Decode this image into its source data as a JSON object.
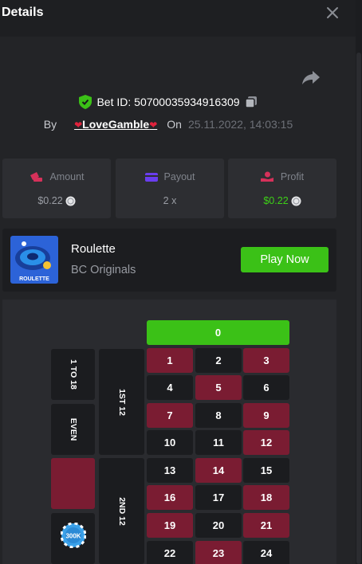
{
  "header": {
    "title": "Details"
  },
  "bet": {
    "id_label": "Bet ID: 50700035934916309",
    "by_label": "By",
    "user": "LoveGamble",
    "on_label": "On",
    "date": "25.11.2022, 14:03:15"
  },
  "stats": {
    "amount": {
      "label": "Amount",
      "value": "$0.22"
    },
    "payout": {
      "label": "Payout",
      "value": "2 x"
    },
    "profit": {
      "label": "Profit",
      "value": "$0.22"
    }
  },
  "game": {
    "thumb_label": "ROULETTE",
    "name": "Roulette",
    "provider": "BC Originals",
    "play_label": "Play Now"
  },
  "board": {
    "zero": "0",
    "side_bets": {
      "low": "1 TO 18",
      "even": "EVEN",
      "dozen1": "1ST 12",
      "dozen2": "2ND 12"
    },
    "chip_label": "300K",
    "numbers": [
      [
        "1",
        "red"
      ],
      [
        "2",
        "black"
      ],
      [
        "3",
        "red"
      ],
      [
        "4",
        "black"
      ],
      [
        "5",
        "red"
      ],
      [
        "6",
        "black"
      ],
      [
        "7",
        "red"
      ],
      [
        "8",
        "black"
      ],
      [
        "9",
        "red"
      ],
      [
        "10",
        "black"
      ],
      [
        "11",
        "black"
      ],
      [
        "12",
        "red"
      ],
      [
        "13",
        "black"
      ],
      [
        "14",
        "red"
      ],
      [
        "15",
        "black"
      ],
      [
        "16",
        "red"
      ],
      [
        "17",
        "black"
      ],
      [
        "18",
        "red"
      ],
      [
        "19",
        "red"
      ],
      [
        "20",
        "black"
      ],
      [
        "21",
        "red"
      ],
      [
        "22",
        "black"
      ],
      [
        "23",
        "red"
      ],
      [
        "24",
        "black"
      ]
    ]
  },
  "colors": {
    "green": "#3bc117",
    "red": "#7a1c32",
    "black": "#1b1c1f",
    "profit": "#3dd117"
  }
}
